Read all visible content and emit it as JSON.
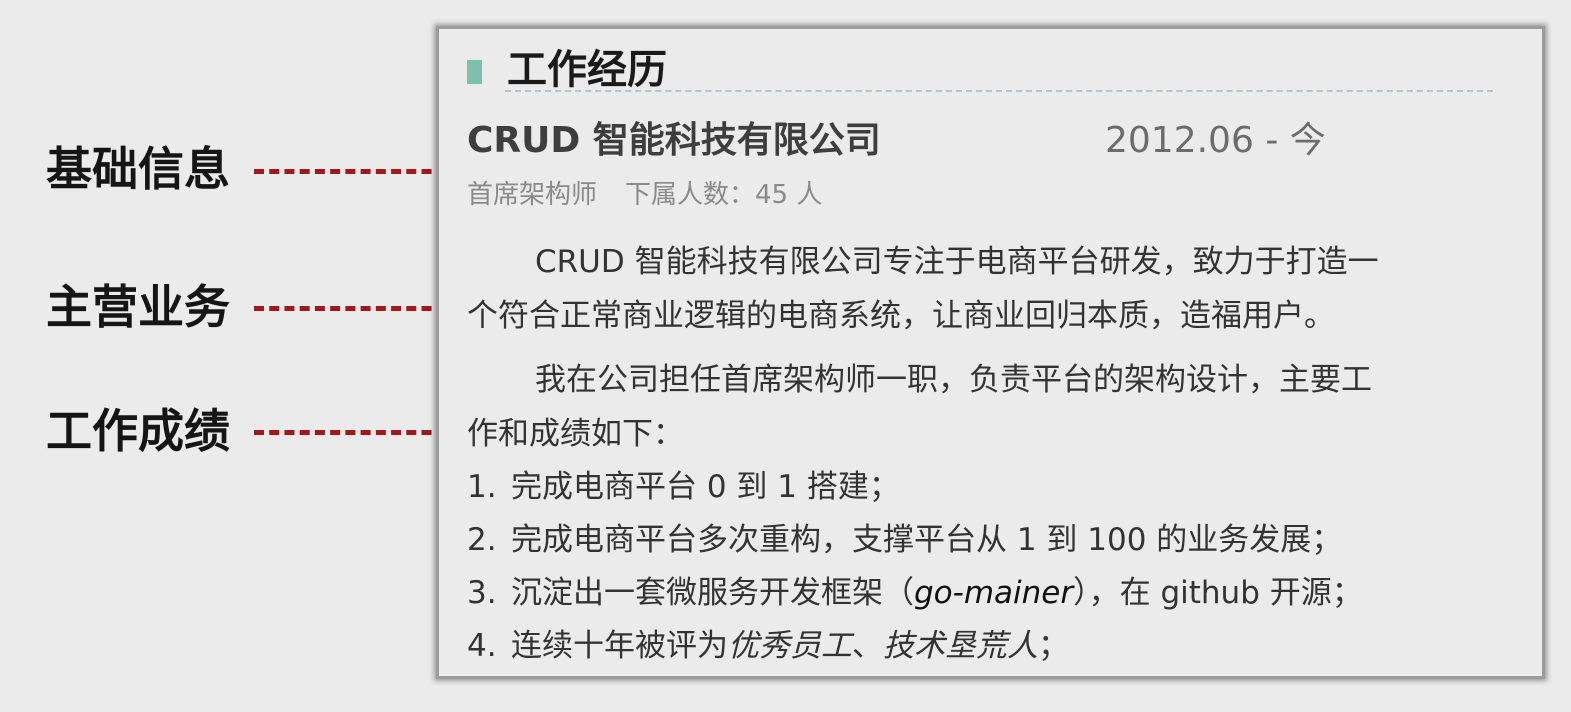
{
  "annotations": {
    "basic_info": "基础信息",
    "main_business": "主营业务",
    "work_results": "工作成绩"
  },
  "resume": {
    "section_title": "工作经历",
    "company": "CRUD 智能科技有限公司",
    "period": "2012.06 - 今",
    "position": "首席架构师",
    "subordinates": "下属人数：45 人",
    "business": {
      "line1": "CRUD 智能科技有限公司专注于电商平台研发，致力于打造一",
      "line2": "个符合正常商业逻辑的电商系统，让商业回归本质，造福用户。"
    },
    "intro": {
      "line1": "我在公司担任首席架构师一职，负责平台的架构设计，主要工",
      "line2": "作和成绩如下："
    },
    "achievements": [
      {
        "num": "1.",
        "text": "完成电商平台 0 到 1 搭建；"
      },
      {
        "num": "2.",
        "text": "完成电商平台多次重构，支撑平台从 1 到 100 的业务发展；"
      },
      {
        "num": "3.",
        "pre": "沉淀出一套微服务开发框架（",
        "em": "go-mainer",
        "post": "），在 github 开源；"
      },
      {
        "num": "4.",
        "pre": "连续十年被评为",
        "em1": "优秀员工",
        "sep": "、",
        "em2": "技术垦荒人",
        "post": "；"
      }
    ]
  },
  "colors": {
    "accent_marker": "#7fbfae",
    "leader_line": "#a01818",
    "rule": "#a9c8d2"
  }
}
